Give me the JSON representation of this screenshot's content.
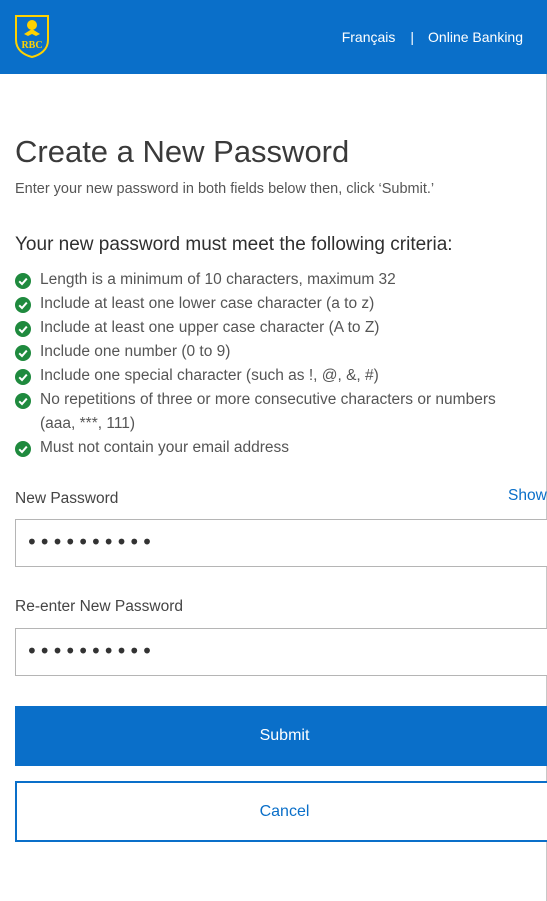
{
  "header": {
    "logo_text": "RBC",
    "language_link": "Français",
    "separator": "|",
    "online_banking_link": "Online Banking",
    "brand_color": "#0a6fc9",
    "logo_color": "#ffd200"
  },
  "page": {
    "title": "Create a New Password",
    "subtitle": "Enter your new password in both fields below then, click ‘Submit.’"
  },
  "criteria": {
    "title": "Your new password must meet the following criteria:",
    "check_icon": "green-check-circle-icon",
    "check_color": "#1f8a3e",
    "items": [
      "Length is a minimum of 10 characters, maximum 32",
      "Include at least one lower case character (a to z)",
      "Include at least one upper case character (A to Z)",
      "Include one number (0 to 9)",
      "Include one special character (such as !, @, &, #)",
      "No repetitions of three or more consecutive characters or numbers (aaa, ***, 111)",
      "Must not contain your email address"
    ]
  },
  "form": {
    "new_password_label": "New Password",
    "show_link": "Show",
    "new_password_value": "••••••••••",
    "reenter_label": "Re-enter New Password",
    "reenter_value": "••••••••••"
  },
  "buttons": {
    "submit": "Submit",
    "cancel": "Cancel"
  }
}
